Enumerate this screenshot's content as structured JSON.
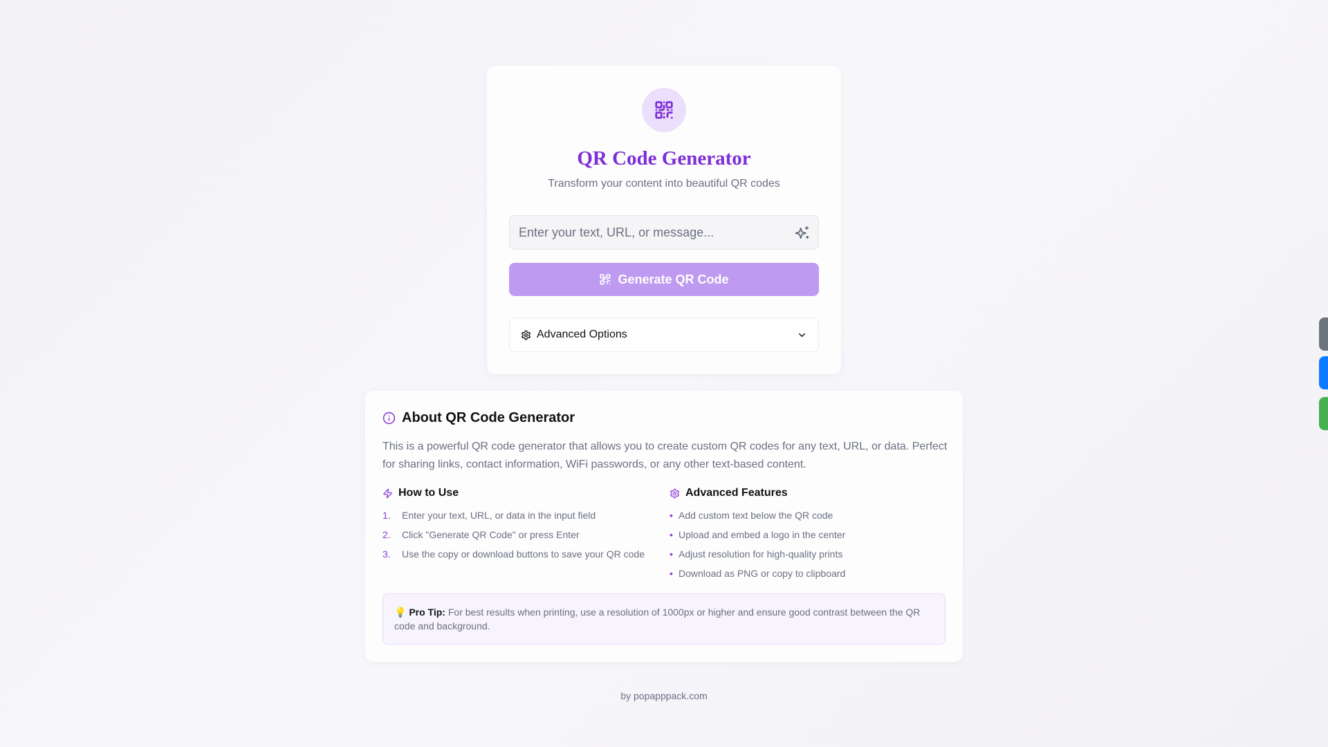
{
  "header": {
    "logo_icon": "qr-code-icon",
    "title": "QR Code Generator",
    "subtitle": "Transform your content into beautiful QR codes"
  },
  "input": {
    "placeholder": "Enter your text, URL, or message...",
    "value": "",
    "icon": "sparkles-icon"
  },
  "generate_button": {
    "label": "Generate QR Code",
    "icon": "qr-code-icon"
  },
  "advanced_options": {
    "label": "Advanced Options",
    "icon": "gear-icon",
    "chevron": "chevron-down-icon"
  },
  "about": {
    "title": "About QR Code Generator",
    "description": "This is a powerful QR code generator that allows you to create custom QR codes for any text, URL, or data. Perfect for sharing links, contact information, WiFi passwords, or any other text-based content.",
    "how_to_use": {
      "title": "How to Use",
      "steps": [
        {
          "num": "1.",
          "text": "Enter your text, URL, or data in the input field"
        },
        {
          "num": "2.",
          "text": "Click \"Generate QR Code\" or press Enter"
        },
        {
          "num": "3.",
          "text": "Use the copy or download buttons to save your QR code"
        }
      ]
    },
    "advanced_features": {
      "title": "Advanced Features",
      "items": [
        "Add custom text below the QR code",
        "Upload and embed a logo in the center",
        "Adjust resolution for high-quality prints",
        "Download as PNG or copy to clipboard"
      ]
    },
    "pro_tip": {
      "emoji": "💡",
      "label": "Pro Tip:",
      "text": "For best results when printing, use a resolution of 1000px or higher and ensure good contrast between the QR code and background."
    }
  },
  "footer": {
    "text": "by popapppack.com"
  },
  "colors": {
    "accent": "#7e2ed6",
    "button": "#be9af0",
    "side_tab_gray": "#6c757d",
    "side_tab_blue": "#0d7bff",
    "side_tab_green": "#46b04f"
  }
}
